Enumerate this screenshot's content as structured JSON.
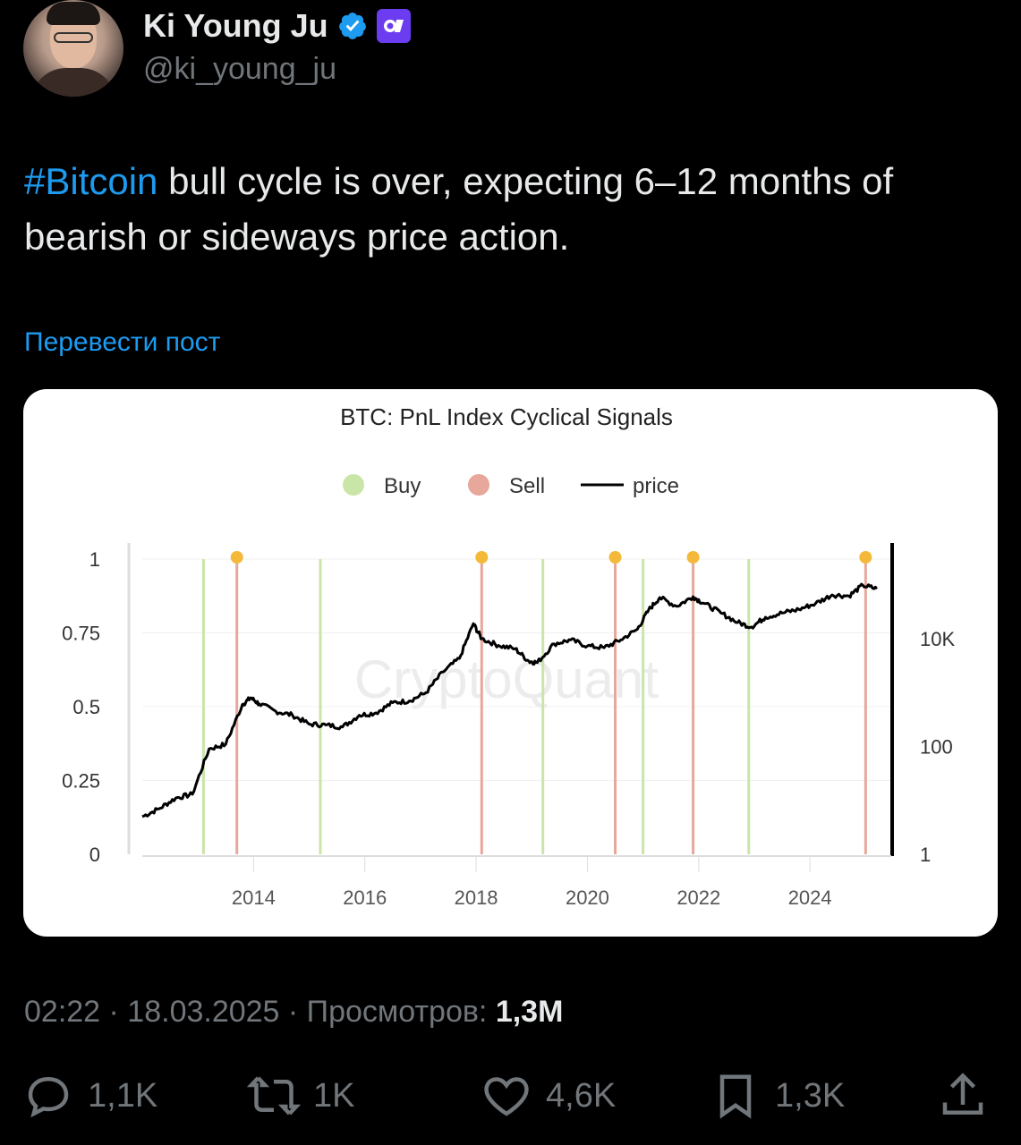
{
  "author": {
    "name": "Ki Young Ju",
    "handle": "@ki_young_ju"
  },
  "post": {
    "hashtag": "#Bitcoin",
    "text": " bull cycle is over, expecting 6–12 months of bearish or sideways price action.",
    "translate_label": "Перевести пост"
  },
  "meta": {
    "time_date": "02:22 · 18.03.2025 · Просмотров: ",
    "views": "1,3M"
  },
  "actions": {
    "replies": "1,1K",
    "reposts": "1K",
    "likes": "4,6K",
    "bookmarks": "1,3K"
  },
  "colors": {
    "buy": "#c9e6a8",
    "sell": "#e7a79b",
    "signal_dot": "#f5b93a",
    "price": "#000000",
    "link": "#1d9bf0"
  },
  "chart_data": {
    "type": "line",
    "title": "BTC: PnL Index Cyclical Signals",
    "watermark": "CryptoQuant",
    "legend": [
      {
        "name": "Buy",
        "kind": "dot"
      },
      {
        "name": "Sell",
        "kind": "dot"
      },
      {
        "name": "price",
        "kind": "line"
      }
    ],
    "legend_position": "top-center",
    "x_ticks": [
      "2014",
      "2016",
      "2018",
      "2020",
      "2022",
      "2024"
    ],
    "y_left_ticks": [
      "0",
      "0.25",
      "0.5",
      "0.75",
      "1"
    ],
    "y_left_range": [
      0,
      1
    ],
    "y_right_ticks": [
      "1",
      "100",
      "10K"
    ],
    "y_right_scale": "log",
    "y_right_range": [
      1,
      300000
    ],
    "buy_signals": [
      2013.1,
      2015.2,
      2019.2,
      2021.0,
      2022.9
    ],
    "sell_signals": [
      2013.7,
      2018.1,
      2020.5,
      2021.9,
      2025.0
    ],
    "price_series": {
      "name": "price",
      "x": [
        2012.0,
        2012.3,
        2012.6,
        2012.9,
        2013.2,
        2013.5,
        2013.8,
        2013.95,
        2014.1,
        2014.4,
        2014.7,
        2015.0,
        2015.3,
        2015.6,
        2015.9,
        2016.2,
        2016.5,
        2016.8,
        2017.1,
        2017.4,
        2017.7,
        2017.95,
        2018.1,
        2018.4,
        2018.7,
        2018.95,
        2019.1,
        2019.4,
        2019.7,
        2020.0,
        2020.3,
        2020.6,
        2020.9,
        2021.1,
        2021.3,
        2021.6,
        2021.9,
        2022.1,
        2022.4,
        2022.7,
        2022.95,
        2023.2,
        2023.5,
        2023.8,
        2024.1,
        2024.4,
        2024.7,
        2024.95,
        2025.2
      ],
      "y": [
        5,
        7,
        11,
        13,
        90,
        110,
        600,
        800,
        620,
        450,
        380,
        260,
        250,
        230,
        380,
        420,
        650,
        700,
        1000,
        2400,
        4300,
        19000,
        10000,
        7500,
        6500,
        3800,
        3600,
        8000,
        9500,
        7300,
        6800,
        9500,
        15000,
        34000,
        58000,
        40000,
        60000,
        45000,
        30000,
        20000,
        16500,
        25000,
        30000,
        35000,
        45000,
        65000,
        62000,
        98000,
        84000
      ]
    }
  }
}
